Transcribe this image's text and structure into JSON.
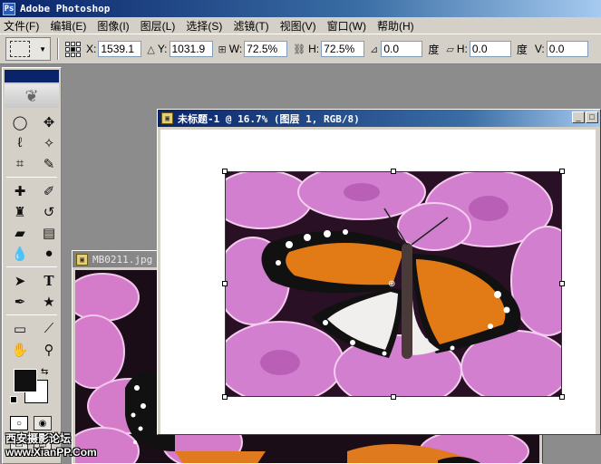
{
  "app": {
    "title": "Adobe Photoshop"
  },
  "menu": {
    "items": [
      "文件(F)",
      "编辑(E)",
      "图像(I)",
      "图层(L)",
      "选择(S)",
      "滤镜(T)",
      "视图(V)",
      "窗口(W)",
      "帮助(H)"
    ]
  },
  "options": {
    "x_label": "X:",
    "x_value": "1539.1",
    "y_label": "Y:",
    "y_value": "1031.9",
    "w_label": "W:",
    "w_value": "72.5%",
    "h_label": "H:",
    "h_value": "72.5%",
    "angle_value": "0.0",
    "angle_unit": "度",
    "hskew_label": "H:",
    "hskew_value": "0.0",
    "hskew_unit": "度",
    "vskew_label": "V:",
    "vskew_value": "0.0"
  },
  "documents": {
    "front_title": "未标题-1 @ 16.7% (图层 1, RGB/8)",
    "back_title": "MB0211.jpg"
  },
  "watermark": {
    "line1": "西安摄影论坛",
    "line2": "www.XianPP.Com"
  },
  "colors": {
    "foreground": "#111111",
    "background": "#ffffff"
  }
}
